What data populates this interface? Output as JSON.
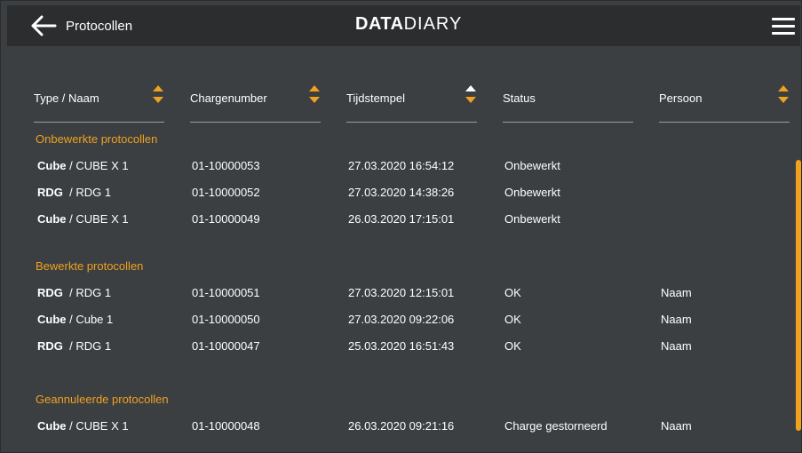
{
  "header": {
    "title": "Protocollen",
    "logo_bold": "DATA",
    "logo_light": "DIARY"
  },
  "columns": [
    "Type / Naam",
    "Chargenumber",
    "Tijdstempel",
    "Status",
    "Persoon"
  ],
  "sections": [
    {
      "title": "Onbewerkte protocollen",
      "rows": [
        {
          "type": "Cube",
          "name": " / CUBE X 1",
          "charge": "01-10000053",
          "time": "27.03.2020 16:54:12",
          "status": "Onbewerkt",
          "person": ""
        },
        {
          "type": "RDG",
          "name": "  / RDG 1",
          "charge": "01-10000052",
          "time": "27.03.2020 14:38:26",
          "status": "Onbewerkt",
          "person": ""
        },
        {
          "type": "Cube",
          "name": " / CUBE X 1",
          "charge": "01-10000049",
          "time": "26.03.2020 17:15:01",
          "status": "Onbewerkt",
          "person": ""
        }
      ]
    },
    {
      "title": "Bewerkte protocollen",
      "rows": [
        {
          "type": "RDG",
          "name": "  / RDG 1",
          "charge": "01-10000051",
          "time": "27.03.2020 12:15:01",
          "status": "OK",
          "person": "Naam"
        },
        {
          "type": "Cube",
          "name": " / Cube 1",
          "charge": "01-10000050",
          "time": "27.03.2020 09:22:06",
          "status": "OK",
          "person": "Naam"
        },
        {
          "type": "RDG",
          "name": "  / RDG 1",
          "charge": "01-10000047",
          "time": "25.03.2020 16:51:43",
          "status": "OK",
          "person": "Naam"
        }
      ]
    },
    {
      "title": "Geannuleerde protocollen",
      "rows": [
        {
          "type": "Cube",
          "name": " / CUBE X 1",
          "charge": "01-10000048",
          "time": "26.03.2020 09:21:16",
          "status": "Charge gestorneerd",
          "person": "Naam"
        }
      ]
    }
  ],
  "colors": {
    "accent": "#f0a11f",
    "background": "#3b3f42",
    "topbar": "#2b2d2f"
  }
}
